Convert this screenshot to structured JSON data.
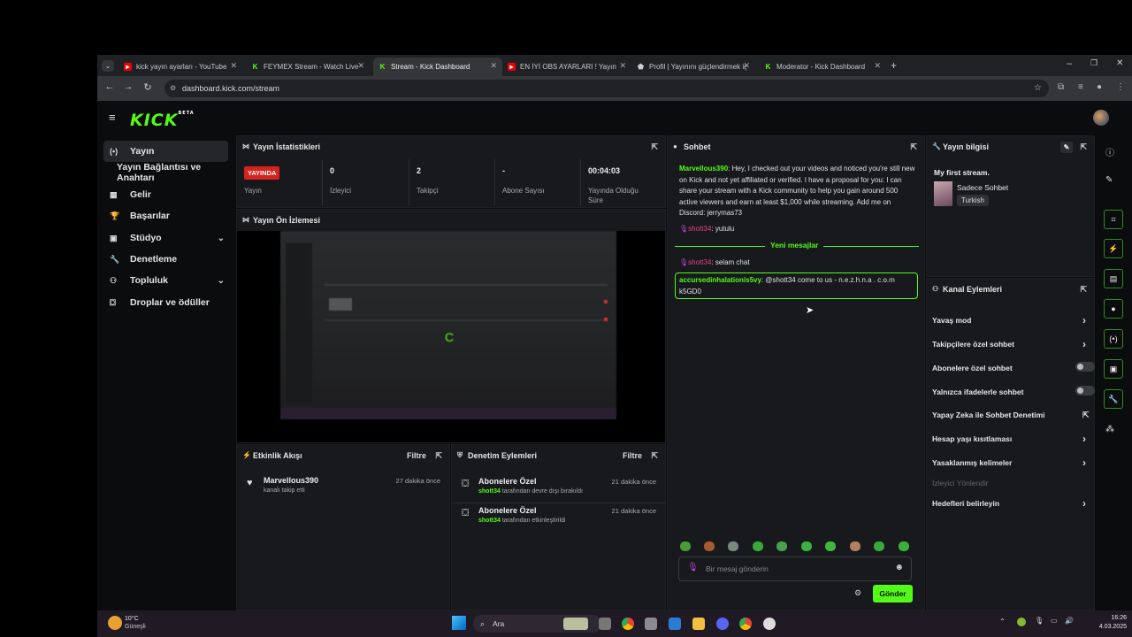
{
  "browser": {
    "tabs": [
      {
        "label": "kick yayın ayarları - YouTube",
        "icon": "youtube-icon"
      },
      {
        "label": "FEYMEX Stream - Watch Live o",
        "icon": "kick-icon"
      },
      {
        "label": "Stream - Kick Dashboard",
        "icon": "kick-icon"
      },
      {
        "label": "EN İYİ OBS AYARLARI ! Yayın ve",
        "icon": "youtube-icon"
      },
      {
        "label": "Profil | Yayınını güçlendirmek iç",
        "icon": "shield-icon"
      },
      {
        "label": "Moderator - Kick Dashboard",
        "icon": "kick-icon"
      }
    ],
    "url": "dashboard.kick.com/stream"
  },
  "header": {
    "logo": "KICK",
    "logo_sup": "BETA"
  },
  "sidebar": {
    "items": [
      {
        "label": "Yayın",
        "icon": "broadcast-icon"
      },
      {
        "label": "Yayın Bağlantısı ve Anahtarı",
        "icon": ""
      },
      {
        "label": "Gelir",
        "icon": "revenue-icon"
      },
      {
        "label": "Başarılar",
        "icon": "trophy-icon"
      },
      {
        "label": "Stüdyo",
        "icon": "studio-icon"
      },
      {
        "label": "Denetleme",
        "icon": "wrench-icon"
      },
      {
        "label": "Topluluk",
        "icon": "community-icon"
      },
      {
        "label": "Droplar ve ödüller",
        "icon": "gift-icon"
      }
    ]
  },
  "stats": {
    "title": "Yayın İstatistikleri",
    "live_badge": "YAYINDA",
    "items": [
      {
        "value": "",
        "label": "Yayın"
      },
      {
        "value": "0",
        "label": "İzleyici"
      },
      {
        "value": "2",
        "label": "Takipçi"
      },
      {
        "value": "-",
        "label": "Abone Sayısı"
      },
      {
        "value": "00:04:03",
        "label": "Yayında Olduğu Süre"
      }
    ]
  },
  "preview": {
    "title": "Yayın Ön İzlemesi"
  },
  "activity": {
    "title": "Etkinlik Akışı",
    "filter": "Filtre",
    "items": [
      {
        "user": "Marvellous390",
        "text": "kanalı takip etti",
        "time": "27 dakika önce"
      }
    ]
  },
  "moderation": {
    "title": "Denetim Eylemleri",
    "filter": "Filtre",
    "items": [
      {
        "title": "Abonelere Özel",
        "user": "shott34",
        "text": "tarafından devre dışı bırakıldı",
        "time": "21 dakika önce"
      },
      {
        "title": "Abonelere Özel",
        "user": "shott34",
        "text": "tarafından etkinleştirildi",
        "time": "21 dakika önce"
      }
    ]
  },
  "chat": {
    "title": "Sohbet",
    "messages": [
      {
        "user": "Marvellous390",
        "text": ": Hey, I checked out your videos and noticed you're still new on Kick and not yet affiliated or verified. I have a proposal for you: I can share your stream with a Kick community to help you gain around 500 active viewers and earn at least $1,000 while streaming. Add me on Discord: jerrymas73"
      },
      {
        "user": "shott34",
        "text": ": yutulu"
      },
      {
        "user": "shott34",
        "text": ": selam chat"
      },
      {
        "user": "accursedinhalationis5vy",
        "text": ": @shott34 come to us - n.e.z.h.n.a . c.o.m k5GD0"
      }
    ],
    "new_messages": "Yeni mesajlar",
    "input_placeholder": "Bir mesaj gönderin",
    "send_label": "Gönder"
  },
  "stream_info": {
    "title": "Yayın bilgisi",
    "stream_title": "My first stream.",
    "category": "Sadece Sohbet",
    "language": "Turkish"
  },
  "channel_actions": {
    "title": "Kanal Eylemleri",
    "items": [
      {
        "label": "Yavaş mod",
        "control": "chevron"
      },
      {
        "label": "Takipçilere özel sohbet",
        "control": "chevron"
      },
      {
        "label": "Abonelere özel sohbet",
        "control": "toggle"
      },
      {
        "label": "Yalnızca ifadelerle sohbet",
        "control": "toggle"
      },
      {
        "label": "Yapay Zeka ile Sohbet Denetimi",
        "control": "external"
      },
      {
        "label": "Hesap yaşı kısıtlaması",
        "control": "chevron"
      },
      {
        "label": "Yasaklanmış kelimeler",
        "control": "chevron"
      },
      {
        "label": "İzleyici Yönlendir",
        "control": "none"
      },
      {
        "label": "Hedefleri belirleyin",
        "control": "chevron"
      }
    ]
  },
  "taskbar": {
    "weather_temp": "10°C",
    "weather_desc": "Güneşli",
    "search": "Ara",
    "time": "16:26",
    "date": "4.03.2025"
  },
  "colors": {
    "accent": "#53fc18",
    "live": "#d6221f",
    "panel": "#18191c"
  }
}
